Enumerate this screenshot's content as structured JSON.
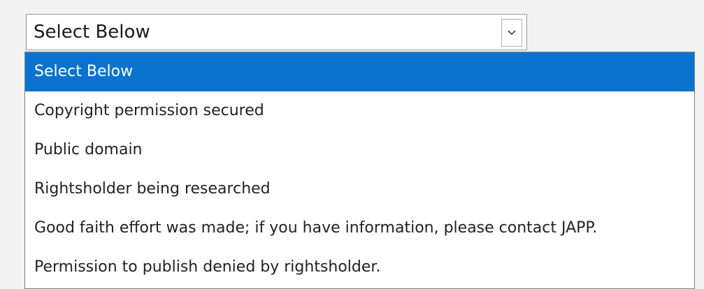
{
  "select": {
    "value": "Select Below",
    "arrow_icon": "chevron-down-icon"
  },
  "dropdown": {
    "options": [
      "Select Below",
      "Copyright permission secured",
      "Public domain",
      "Rightsholder being researched",
      "Good faith effort was made; if you have information, please contact JAPP.",
      "Permission to publish denied by rightsholder."
    ],
    "selected_index": 0
  },
  "colors": {
    "highlight": "#0a73d0",
    "highlight_text": "#ffffff",
    "background": "#f2f2f2"
  }
}
